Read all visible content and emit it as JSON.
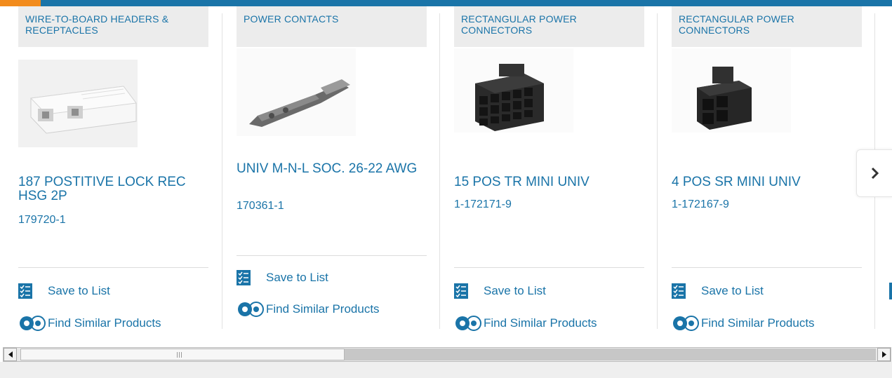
{
  "carousel": {
    "cards": [
      {
        "category": "WIRE-TO-BOARD HEADERS & RECEPTACLES",
        "title": "187 POSTITIVE LOCK REC HSG 2P",
        "part_number": "179720-1",
        "save_label": "Save to List",
        "similar_label": "Find Similar Products"
      },
      {
        "category": "POWER CONTACTS",
        "title": "UNIV M-N-L SOC. 26-22 AWG",
        "part_number": "170361-1",
        "save_label": "Save to List",
        "similar_label": "Find Similar Products"
      },
      {
        "category": "RECTANGULAR POWER CONNECTORS",
        "title": "15 POS TR MINI UNIV",
        "part_number": "1-172171-9",
        "save_label": "Save to List",
        "similar_label": "Find Similar Products"
      },
      {
        "category": "RECTANGULAR POWER CONNECTORS",
        "title": "4 POS SR MINI UNIV",
        "part_number": "1-172167-9",
        "save_label": "Save to List",
        "similar_label": "Find Similar Products"
      }
    ],
    "next_icon": "chevron-right-icon"
  },
  "colors": {
    "link_blue": "#1a74a8",
    "accent_orange": "#f28b1c",
    "category_bg": "#ececec"
  }
}
